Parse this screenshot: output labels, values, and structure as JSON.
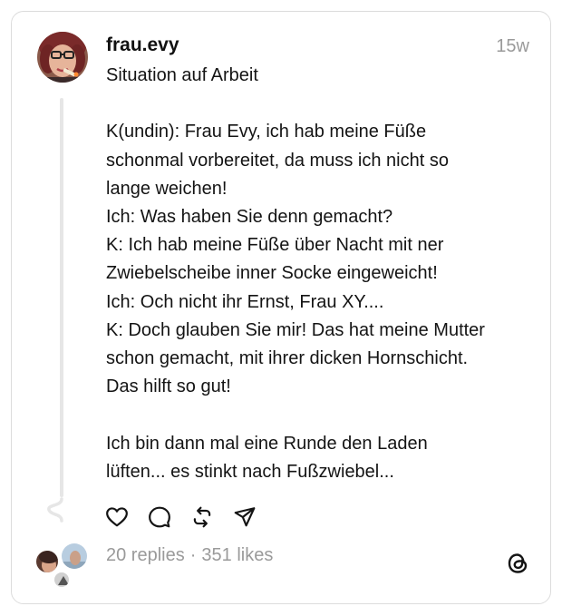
{
  "post": {
    "username": "frau.evy",
    "time_ago": "15w",
    "lines": [
      "Situation auf Arbeit",
      "",
      "K(undin): Frau Evy, ich hab meine Füße",
      "schonmal vorbereitet, da muss ich nicht so",
      "lange weichen!",
      "Ich: Was haben Sie denn gemacht?",
      "K: Ich hab meine Füße über Nacht mit ner",
      "Zwiebelscheibe inner Socke eingeweicht!",
      "Ich: Och nicht ihr Ernst, Frau XY....",
      "K: Doch glauben Sie mir! Das hat meine Mutter",
      "schon gemacht, mit ihrer dicken Hornschicht.",
      "Das hilft so gut!",
      "",
      "Ich bin dann mal eine Runde den Laden",
      "lüften... es stinkt nach Fußzwiebel..."
    ]
  },
  "actions": [
    "heart-icon",
    "comment-icon",
    "repost-icon",
    "share-icon"
  ],
  "stats": {
    "replies": "20 replies",
    "separator": "·",
    "likes": "351 likes"
  },
  "colors": {
    "text": "#141414",
    "muted": "#9a9a9a",
    "border": "#dcdcdc",
    "thread_line": "#e6e6e6"
  }
}
